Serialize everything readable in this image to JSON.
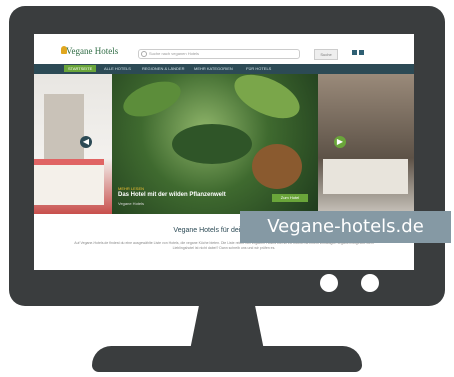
{
  "site": {
    "logo_text": "Vegane Hotels",
    "search_placeholder": "Suche nach veganen Hotels",
    "search_button": "Suche",
    "nav": [
      "STARTSEITE",
      "ALLE HOTELS",
      "REGIONEN & LÄNDER",
      "MEHR KATEGORIEN",
      "FÜR HOTELS"
    ],
    "hero": {
      "caption_tag": "MEHR LESEN",
      "caption_title": "Das Hotel mit der wilden Pflanzenwelt",
      "caption_sub": "Vegane Hotels",
      "cta_label": "Zum Hotel"
    },
    "section_title": "Vegane Hotels für deinen Urlaub",
    "section_body": "Auf Vegane-Hotels.de findest du eine ausgewählte Liste von Hotels, die vegane Küche bieten. Die Liste reicht von veganen Hotels bis hin zu Hotels mit einem vielfältigen veganen Angebot. Dein Lieblingshotel ist nicht dabei? Dann schreib uns und wir prüfen es."
  },
  "label": "Vegane-hotels.de",
  "colors": {
    "monitor": "#3a3d3e",
    "nav": "#2c4a55",
    "accent": "#6aa53a",
    "label_bg": "#8599a4"
  }
}
